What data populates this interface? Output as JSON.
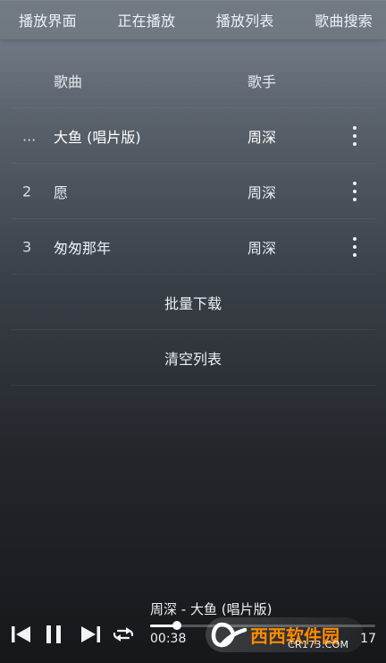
{
  "tabs": [
    "播放界面",
    "正在播放",
    "播放列表",
    "歌曲搜索"
  ],
  "list": {
    "header": {
      "song": "歌曲",
      "artist": "歌手"
    },
    "rows": [
      {
        "index": "...",
        "song": "大鱼 (唱片版)",
        "artist": "周深"
      },
      {
        "index": "2",
        "song": "愿",
        "artist": "周深"
      },
      {
        "index": "3",
        "song": "匆匆那年",
        "artist": "周深"
      }
    ],
    "actions": {
      "batch_download": "批量下载",
      "clear_list": "清空列表"
    }
  },
  "player": {
    "now_playing": "周深 - 大鱼 (唱片版)",
    "current_time": "00:38",
    "total_time": "17",
    "progress": 0.12
  },
  "watermark": {
    "brand_text": "西西软件园",
    "domain_text": "CR173.COM"
  },
  "colors": {
    "text": "#edf1f5",
    "brand": "#ff8a00"
  },
  "icons": {
    "more": "more-vert-icon",
    "previous": "skip-previous-icon",
    "pause": "pause-icon",
    "next": "skip-next-icon",
    "repeat": "repeat-icon"
  }
}
